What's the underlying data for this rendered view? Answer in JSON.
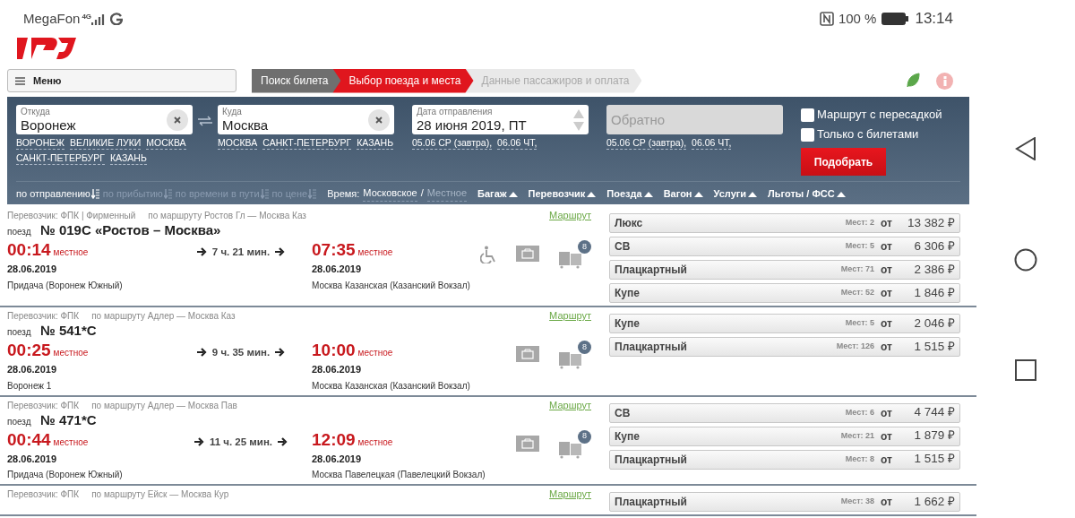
{
  "status_bar": {
    "carrier": "MegaFon",
    "network": "4G",
    "battery": "100 %",
    "time": "13:14"
  },
  "menu": {
    "label": "Меню"
  },
  "steps": [
    {
      "label": "Поиск билета",
      "selected": false,
      "done": true
    },
    {
      "label": "Выбор поезда и места",
      "selected": true,
      "done": false
    },
    {
      "label": "Данные пассажиров и оплата",
      "selected": false,
      "done": false
    }
  ],
  "search": {
    "from": {
      "label": "Откуда",
      "value": "Воронеж",
      "suggestions": [
        "ВОРОНЕЖ",
        "ВЕЛИКИЕ ЛУКИ",
        "МОСКВА",
        "САНКТ-ПЕТЕРБУРГ",
        "КАЗАНЬ"
      ]
    },
    "to": {
      "label": "Куда",
      "value": "Москва",
      "suggestions": [
        "МОСКВА",
        "САНКТ-ПЕТЕРБУРГ",
        "КАЗАНЬ"
      ]
    },
    "date": {
      "label": "Дата отправления",
      "value": "28 июня 2019, ПТ",
      "suggestions": [
        "05.06 СР (завтра),",
        "06.06 ЧТ,"
      ]
    },
    "return": {
      "placeholder": "Обратно",
      "suggestions": [
        "05.06 СР (завтра),",
        "06.06 ЧТ,"
      ]
    },
    "checkboxes": [
      {
        "label": "Маршрут с пересадкой",
        "checked": false
      },
      {
        "label": "Только с билетами",
        "checked": false
      }
    ],
    "submit": "Подобрать"
  },
  "sort": [
    {
      "label": "по отправлению",
      "selected": true
    },
    {
      "label": "по прибытию",
      "selected": false
    },
    {
      "label": "по времени в пути",
      "selected": false
    },
    {
      "label": "по цене",
      "selected": false
    }
  ],
  "time_zone": {
    "label": "Время:",
    "separator": "/",
    "options": [
      {
        "label": "Московское",
        "selected": true
      },
      {
        "label": "Местное",
        "selected": false
      }
    ]
  },
  "filters": [
    "Багаж",
    "Перевозчик",
    "Поезда",
    "Вагон",
    "Услуги",
    "Льготы / ФСС"
  ],
  "trains": [
    {
      "info": "Перевозчик: ФПК | Фирменный",
      "route": "по маршруту Ростов Гл — Москва Каз",
      "route_link": "Маршрут",
      "prefix": "поезд",
      "number": "№ 019С «Ростов – Москва»",
      "dep_time": "00:14",
      "dep_note": "местное",
      "dep_date": "28.06.2019",
      "dep_station": "Придача (Воронеж Южный)",
      "duration": "7 ч. 21 мин.",
      "arr_time": "07:35",
      "arr_note": "местное",
      "arr_date": "28.06.2019",
      "arr_station": "Москва Казанская (Казанский Вокзал)",
      "amenities": [
        {
          "kind": "wheelchair"
        },
        {
          "kind": "baggage"
        },
        {
          "kind": "cars",
          "count": "8"
        }
      ],
      "fares": [
        {
          "class": "Люкс",
          "seats": "Мест: 2",
          "from": "от",
          "price": "13 382 ₽"
        },
        {
          "class": "СВ",
          "seats": "Мест: 5",
          "from": "от",
          "price": "6 306 ₽"
        },
        {
          "class": "Плацкартный",
          "seats": "Мест: 71",
          "from": "от",
          "price": "2 386 ₽"
        },
        {
          "class": "Купе",
          "seats": "Мест: 52",
          "from": "от",
          "price": "1 846 ₽"
        }
      ]
    },
    {
      "info": "Перевозчик: ФПК",
      "route": "по маршруту Адлер — Москва Каз",
      "route_link": "Маршрут",
      "prefix": "поезд",
      "number": "№ 541*С",
      "dep_time": "00:25",
      "dep_note": "местное",
      "dep_date": "28.06.2019",
      "dep_station": "Воронеж 1",
      "duration": "9 ч. 35 мин.",
      "arr_time": "10:00",
      "arr_note": "местное",
      "arr_date": "28.06.2019",
      "arr_station": "Москва Казанская (Казанский Вокзал)",
      "amenities": [
        {
          "kind": "baggage"
        },
        {
          "kind": "cars",
          "count": "8"
        }
      ],
      "fares": [
        {
          "class": "Купе",
          "seats": "Мест: 5",
          "from": "от",
          "price": "2 046 ₽"
        },
        {
          "class": "Плацкартный",
          "seats": "Мест: 126",
          "from": "от",
          "price": "1 515 ₽"
        }
      ]
    },
    {
      "info": "Перевозчик: ФПК",
      "route": "по маршруту Адлер — Москва Пав",
      "route_link": "Маршрут",
      "prefix": "поезд",
      "number": "№ 471*С",
      "dep_time": "00:44",
      "dep_note": "местное",
      "dep_date": "28.06.2019",
      "dep_station": "Придача (Воронеж Южный)",
      "duration": "11 ч. 25 мин.",
      "arr_time": "12:09",
      "arr_note": "местное",
      "arr_date": "28.06.2019",
      "arr_station": "Москва Павелецкая (Павелецкий Вокзал)",
      "amenities": [
        {
          "kind": "baggage"
        },
        {
          "kind": "cars",
          "count": "8"
        }
      ],
      "fares": [
        {
          "class": "СВ",
          "seats": "Мест: 6",
          "from": "от",
          "price": "4 744 ₽"
        },
        {
          "class": "Купе",
          "seats": "Мест: 21",
          "from": "от",
          "price": "1 879 ₽"
        },
        {
          "class": "Плацкартный",
          "seats": "Мест: 8",
          "from": "от",
          "price": "1 515 ₽"
        }
      ]
    },
    {
      "info": "Перевозчик: ФПК",
      "route": "по маршруту Ейск — Москва Кур",
      "route_link": "Маршрут",
      "fares": [
        {
          "class": "Плацкартный",
          "seats": "Мест: 38",
          "from": "от",
          "price": "1 662 ₽"
        }
      ]
    }
  ]
}
